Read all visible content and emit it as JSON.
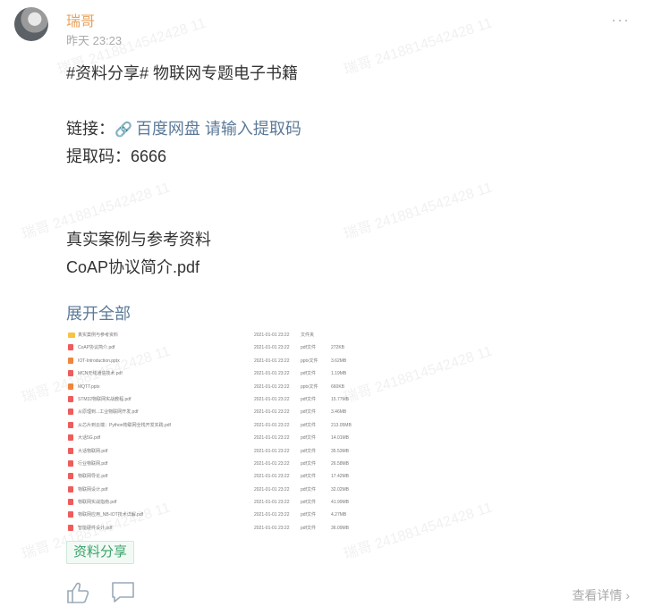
{
  "post": {
    "author": "瑞哥",
    "time": "昨天 23:23",
    "more": "···",
    "title": "#资料分享# 物联网专题电子书籍",
    "link_prefix": "链接：",
    "link_icon": "🔗",
    "link_text": "百度网盘 请输入提取码",
    "code_line": "提取码：6666",
    "line_case": "真实案例与参考资料",
    "line_pdf": "CoAP协议简介.pdf",
    "expand": "展开全部",
    "tag": "资料分享",
    "detail": "查看详情",
    "detail_arrow": "›"
  },
  "watermark": "瑞哥 2418814542428 11",
  "files": [
    {
      "icon": "folder",
      "name": "真实案例与参考资料",
      "date": "2021-01-01 23:22",
      "type": "文件夹",
      "size": ""
    },
    {
      "icon": "pdf",
      "name": "CoAP协议简介.pdf",
      "date": "2021-01-01 23:22",
      "type": "pdf文件",
      "size": "272KB"
    },
    {
      "icon": "ppt",
      "name": "IOT-Introduction.pptx",
      "date": "2021-01-01 23:22",
      "type": "pptx文件",
      "size": "3.62MB"
    },
    {
      "icon": "pdf",
      "name": "MCN无线通信技术.pdf",
      "date": "2021-01-01 23:22",
      "type": "pdf文件",
      "size": "1.19MB"
    },
    {
      "icon": "ppt",
      "name": "MQTT.pptx",
      "date": "2021-01-01 23:22",
      "type": "pptx文件",
      "size": "660KB"
    },
    {
      "icon": "pdf",
      "name": "STM32物联网实战教程.pdf",
      "date": "2021-01-01 23:22",
      "type": "pdf文件",
      "size": "15.77MB"
    },
    {
      "icon": "pdf",
      "name": "从原理到...工业物联网开发.pdf",
      "date": "2021-01-01 23:22",
      "type": "pdf文件",
      "size": "3.46MB"
    },
    {
      "icon": "pdf",
      "name": "从芯片到云端：Python物联网全栈开发实践.pdf",
      "date": "2021-01-01 23:22",
      "type": "pdf文件",
      "size": "213.05MB"
    },
    {
      "icon": "pdf",
      "name": "大话5G.pdf",
      "date": "2021-01-01 23:22",
      "type": "pdf文件",
      "size": "14.01MB"
    },
    {
      "icon": "pdf",
      "name": "大话物联网.pdf",
      "date": "2021-01-01 23:22",
      "type": "pdf文件",
      "size": "35.53MB"
    },
    {
      "icon": "pdf",
      "name": "行业物联网.pdf",
      "date": "2021-01-01 23:22",
      "type": "pdf文件",
      "size": "26.58MB"
    },
    {
      "icon": "pdf",
      "name": "物联网导论.pdf",
      "date": "2021-01-01 23:22",
      "type": "pdf文件",
      "size": "17.42MB"
    },
    {
      "icon": "pdf",
      "name": "物联网设计.pdf",
      "date": "2021-01-01 23:22",
      "type": "pdf文件",
      "size": "32.02MB"
    },
    {
      "icon": "pdf",
      "name": "物联网实战指南.pdf",
      "date": "2021-01-01 23:22",
      "type": "pdf文件",
      "size": "41.99MB"
    },
    {
      "icon": "pdf",
      "name": "物联网应用_NB-IOT技术详解.pdf",
      "date": "2021-01-01 23:22",
      "type": "pdf文件",
      "size": "4.27MB"
    },
    {
      "icon": "pdf",
      "name": "智能硬件设计.pdf",
      "date": "2021-01-01 23:22",
      "type": "pdf文件",
      "size": "36.09MB"
    }
  ],
  "colors": {
    "author": "#e8a15a",
    "link": "#5c7a99",
    "tag": "#3aa26a"
  },
  "icons": {
    "like": "thumbs-up-icon",
    "comment": "comment-icon"
  }
}
